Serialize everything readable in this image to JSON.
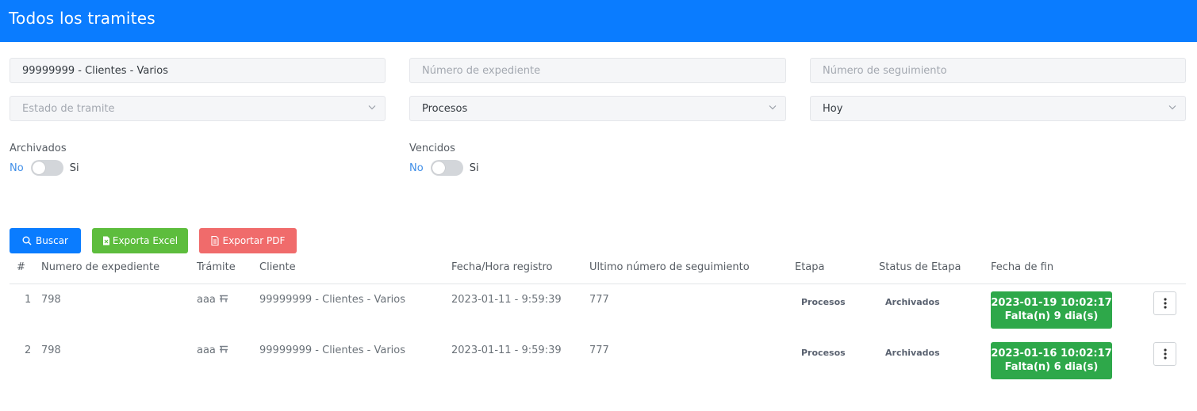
{
  "header": {
    "title": "Todos los tramites"
  },
  "filters": {
    "client": {
      "value": "99999999 - Clientes - Varios"
    },
    "expediente": {
      "placeholder": "Número de expediente"
    },
    "seguimiento": {
      "placeholder": "Número de seguimiento"
    },
    "estado": {
      "placeholder": "Estado de tramite"
    },
    "procesos": {
      "value": "Procesos"
    },
    "periodo": {
      "value": "Hoy"
    }
  },
  "toggles": {
    "archivados": {
      "label": "Archivados",
      "off": "No",
      "on": "Si",
      "checked": false
    },
    "vencidos": {
      "label": "Vencidos",
      "off": "No",
      "on": "Si",
      "checked": false
    }
  },
  "buttons": {
    "buscar": "Buscar",
    "excel": "Exporta Excel",
    "pdf": "Exportar PDF"
  },
  "colors": {
    "header": "#0a7cff",
    "buscar": "#0a7cff",
    "excel": "#5dbd3d",
    "pdf": "#f06b6b",
    "due": "#2ea84a"
  },
  "table": {
    "columns": [
      "#",
      "Numero de expediente",
      "Trámite",
      "Cliente",
      "Fecha/Hora registro",
      "Ultimo número de seguimiento",
      "Etapa",
      "Status de Etapa",
      "Fecha de fin"
    ],
    "rows": [
      {
        "num": "1",
        "expediente": "798",
        "tramite": "aaa",
        "cliente": "99999999 - Clientes - Varios",
        "fecha": "2023-01-11 - 9:59:39",
        "seguimiento": "777",
        "etapa": "Procesos",
        "status": "Archivados",
        "fin_date": "2023-01-19 10:02:17",
        "fin_left": "Falta(n) 9 dia(s)"
      },
      {
        "num": "2",
        "expediente": "798",
        "tramite": "aaa",
        "cliente": "99999999 - Clientes - Varios",
        "fecha": "2023-01-11 - 9:59:39",
        "seguimiento": "777",
        "etapa": "Procesos",
        "status": "Archivados",
        "fin_date": "2023-01-16 10:02:17",
        "fin_left": "Falta(n) 6 dia(s)"
      }
    ]
  }
}
